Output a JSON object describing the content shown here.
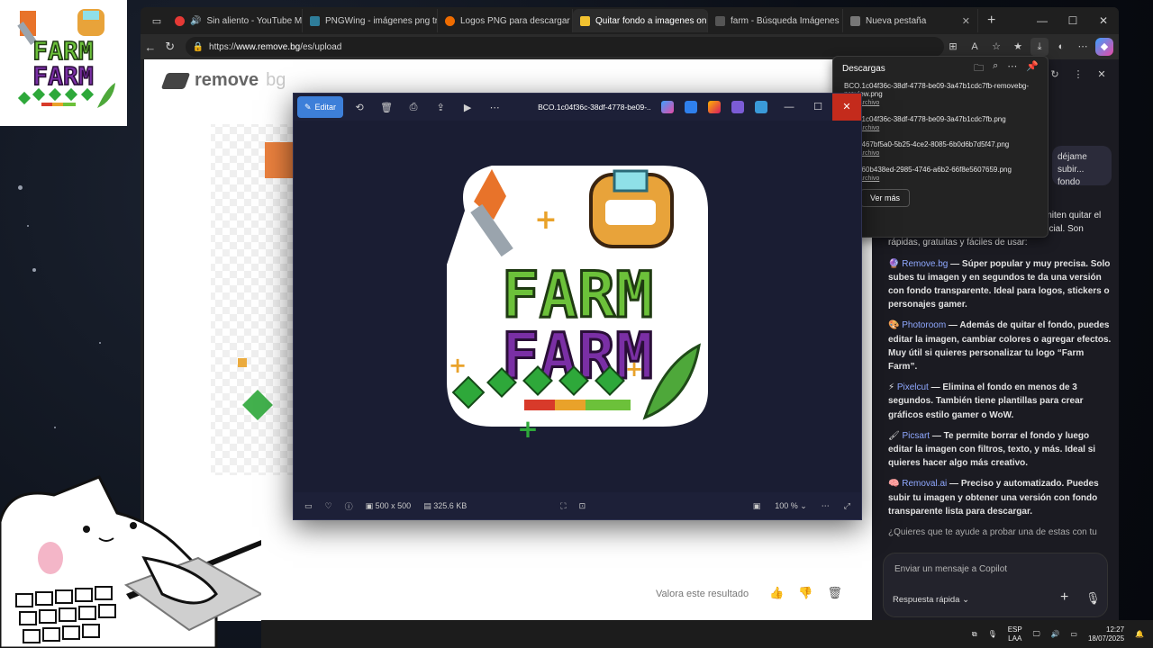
{
  "browser": {
    "tabs": [
      {
        "label": "Sin aliento - YouTube Mus",
        "fav_color": "#e53935"
      },
      {
        "label": "PNGWing - imágenes png tran",
        "fav_color": "#2e7d9a"
      },
      {
        "label": "Logos PNG para descargar gra",
        "fav_color": "#ef6c00"
      },
      {
        "label": "Quitar fondo a imagenes onlin",
        "fav_color": "#f2c230"
      },
      {
        "label": "farm - Búsqueda Imágenes",
        "fav_color": "#555555"
      },
      {
        "label": "Nueva pestaña",
        "fav_color": "#777777"
      }
    ],
    "url_prefix": "https://",
    "url_domain": "www.remove.bg",
    "url_path": "/es/upload"
  },
  "page": {
    "logo_main": "remove",
    "logo_suffix": "bg",
    "rate_label": "Valora este resultado"
  },
  "downloads": {
    "title": "Descargas",
    "items": [
      {
        "name": "BCO.1c04f36c-38df-4778-be09-3a47b1cdc7fb-removebg-preview.png",
        "action": "Abrir archivo"
      },
      {
        "name": "BCO.1c04f36c-38df-4778-be09-3a47b1cdc7fb.png",
        "action": "Abrir archivo"
      },
      {
        "name": "BCO.467bf5a0-5b25-4ce2-8085-6b0d6b7d5f47.png",
        "action": "Abrir archivo"
      },
      {
        "name": "BCO.60b438ed-2985-4746-a6b2-66f8e5607659.png",
        "action": "Abrir archivo"
      }
    ],
    "more_label": "Ver más"
  },
  "viewer": {
    "edit_label": "Editar",
    "title": "BCO.1c04f36c-38df-4778-be09-...",
    "dimensions": "500 x 500",
    "size": "325.6 KB",
    "zoom": "100 %",
    "logo_line1": "FARM",
    "logo_line2": "FARM"
  },
  "copilot": {
    "bubble": "déjame subir... fondo",
    "paragraphs": [
      {
        "intro": "Aquí tienes algunas páginas que te permiten quitar el fondo de imágenes con inteligencia artificial. Son rápidas, gratuitas y fáciles de usar:"
      },
      {
        "name": "Remove.bg",
        "text": " — Súper popular y muy precisa. Solo subes tu imagen y en segundos te da una versión con fondo transparente. Ideal para logos, stickers o personajes gamer."
      },
      {
        "name": "Photoroom",
        "text": " — Además de quitar el fondo, puedes editar la imagen, cambiar colores o agregar efectos. Muy útil si quieres personalizar tu logo “Farm Farm”."
      },
      {
        "name": "Pixelcut",
        "text": " — Elimina el fondo en menos de 3 segundos. También tiene plantillas para crear gráficos estilo gamer o WoW."
      },
      {
        "name": "Picsart",
        "text": " — Te permite borrar el fondo y luego editar la imagen con filtros, texto, y más. Ideal si quieres hacer algo más creativo."
      },
      {
        "name": "Removal.ai",
        "text": " — Preciso y automatizado. Puedes subir tu imagen y obtener una versión con fondo transparente lista para descargar."
      },
      {
        "intro": "¿Quieres que te ayude a probar una de estas con tu"
      }
    ],
    "input_placeholder": "Enviar un mensaje a Copilot",
    "mode_label": "Respuesta rápida"
  },
  "taskbar": {
    "lang1": "ESP",
    "lang2": "LAA",
    "time": "12:27",
    "date": "18/07/2025"
  },
  "colors": {
    "accent": "#3d7fd9",
    "close_red": "#c42b1c",
    "farm_green": "#6cc13a",
    "farm_purple": "#7a2fa5",
    "gem_green": "#2ea83a"
  }
}
